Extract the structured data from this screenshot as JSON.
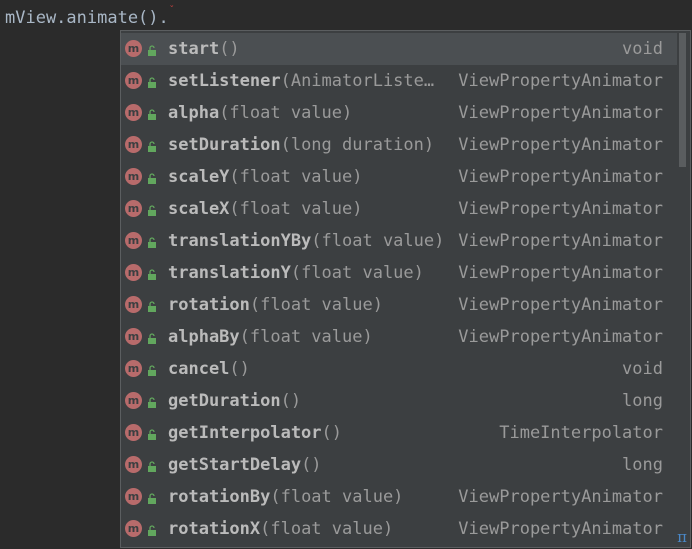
{
  "editor": {
    "code_text": "mView.animate().",
    "error_mark": "ˇ"
  },
  "popup": {
    "items": [
      {
        "name": "start",
        "params": "()",
        "ret": "void"
      },
      {
        "name": "setListener",
        "params": "(AnimatorListe…",
        "ret": "ViewPropertyAnimator"
      },
      {
        "name": "alpha",
        "params": "(float value)",
        "ret": "ViewPropertyAnimator"
      },
      {
        "name": "setDuration",
        "params": "(long duration)",
        "ret": "ViewPropertyAnimator"
      },
      {
        "name": "scaleY",
        "params": "(float value)",
        "ret": "ViewPropertyAnimator"
      },
      {
        "name": "scaleX",
        "params": "(float value)",
        "ret": "ViewPropertyAnimator"
      },
      {
        "name": "translationYBy",
        "params": "(float value)",
        "ret": "ViewPropertyAnimator"
      },
      {
        "name": "translationY",
        "params": "(float value)",
        "ret": "ViewPropertyAnimator"
      },
      {
        "name": "rotation",
        "params": "(float value)",
        "ret": "ViewPropertyAnimator"
      },
      {
        "name": "alphaBy",
        "params": "(float value)",
        "ret": "ViewPropertyAnimator"
      },
      {
        "name": "cancel",
        "params": "()",
        "ret": "void"
      },
      {
        "name": "getDuration",
        "params": "()",
        "ret": "long"
      },
      {
        "name": "getInterpolator",
        "params": "()",
        "ret": "TimeInterpolator"
      },
      {
        "name": "getStartDelay",
        "params": "()",
        "ret": "long"
      },
      {
        "name": "rotationBy",
        "params": "(float value)",
        "ret": "ViewPropertyAnimator"
      },
      {
        "name": "rotationX",
        "params": "(float value)",
        "ret": "ViewPropertyAnimator"
      }
    ],
    "icon_method_letter": "m",
    "icon_method": "method-icon",
    "icon_visibility": "public-lock-icon",
    "pi_link": "π",
    "colors": {
      "method_icon": "#b86b6b",
      "lock_icon": "#62a75e",
      "selected_row": "#4b4f52",
      "pi_link": "#4a88c7"
    }
  }
}
